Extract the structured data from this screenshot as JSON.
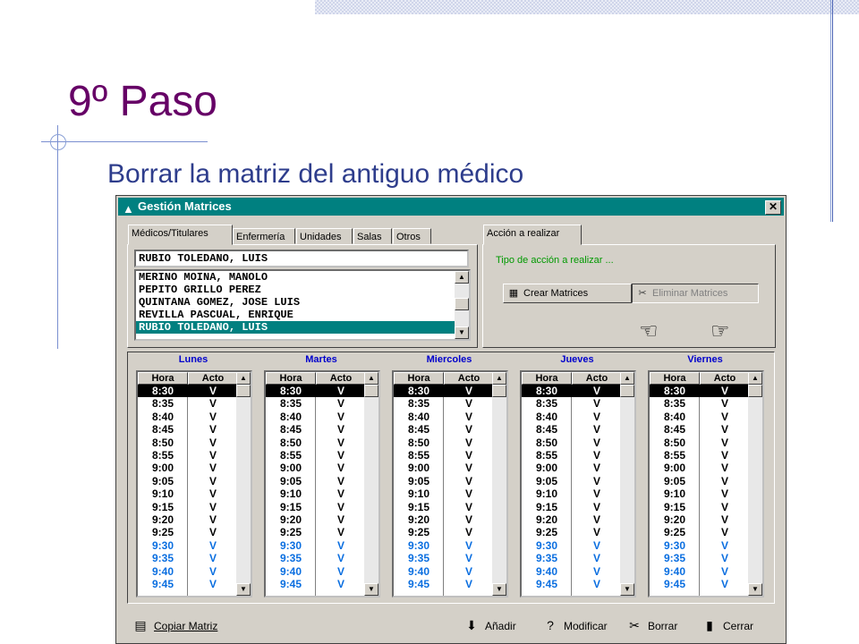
{
  "slide": {
    "title": "9º Paso",
    "subtitle": "Borrar la matriz del antiguo médico"
  },
  "window": {
    "title": "Gestión Matrices",
    "close_label": "✕"
  },
  "tabs": [
    "Médicos/Titulares",
    "Enfermería",
    "Unidades",
    "Salas",
    "Otros"
  ],
  "action_tab": "Acción a realizar",
  "selected_name": "RUBIO TOLEDANO, LUIS",
  "doctor_list": [
    "MERINO MOINA, MANOLO",
    "PEPITO GRILLO PEREZ",
    "QUINTANA GOMEZ, JOSE LUIS",
    "REVILLA PASCUAL, ENRIQUE",
    "RUBIO TOLEDANO, LUIS"
  ],
  "action": {
    "prompt": "Tipo de acción a realizar ...",
    "create_label": "Crear Matrices",
    "delete_label": "Eliminar Matrices"
  },
  "days": [
    {
      "name": "Lunes"
    },
    {
      "name": "Martes"
    },
    {
      "name": "Miercoles"
    },
    {
      "name": "Jueves"
    },
    {
      "name": "Viernes"
    }
  ],
  "table_headers": {
    "hora": "Hora",
    "acto": "Acto"
  },
  "times": [
    "8:30",
    "8:35",
    "8:40",
    "8:45",
    "8:50",
    "8:55",
    "9:00",
    "9:05",
    "9:10",
    "9:15",
    "9:20",
    "9:25",
    "9:30",
    "9:35",
    "9:40",
    "9:45"
  ],
  "acto_value": "V",
  "blue_from_index": 12,
  "bottom_buttons": {
    "copy": "Copiar Matriz",
    "add": "Añadir",
    "modify": "Modificar",
    "delete": "Borrar",
    "close": "Cerrar"
  },
  "colors": {
    "title": "#660066",
    "subtitle": "#2e3d8c",
    "titlebar": "#008080",
    "selection": "#008080",
    "day_header": "#0000cc",
    "late_times": "#0a6ee0",
    "prompt": "#009900"
  }
}
